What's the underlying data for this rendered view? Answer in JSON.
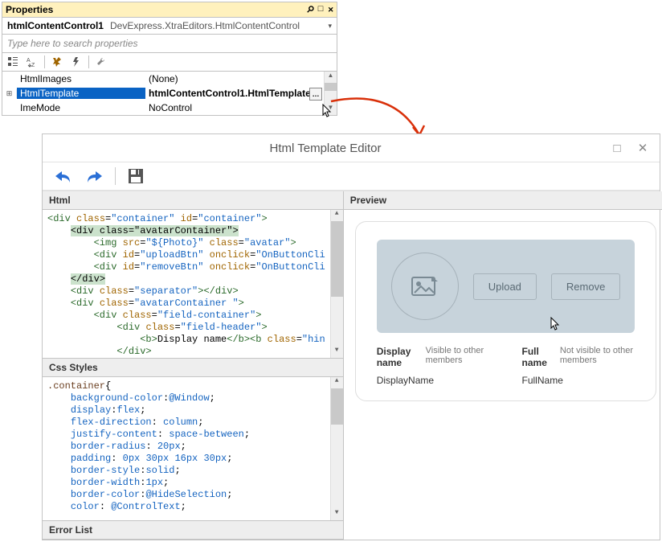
{
  "props": {
    "title": "Properties",
    "object_name": "htmlContentControl1",
    "object_type": "DevExpress.XtraEditors.HtmlContentControl",
    "search_placeholder": "Type here to search properties",
    "rows": [
      {
        "name": "HtmlImages",
        "value": "(None)",
        "expander": ""
      },
      {
        "name": "HtmlTemplate",
        "value": "htmlContentControl1.HtmlTemplate",
        "expander": "⊞",
        "selected": true,
        "ellipsis": true
      },
      {
        "name": "ImeMode",
        "value": "NoControl",
        "expander": ""
      }
    ]
  },
  "editor": {
    "title": "Html Template Editor",
    "tabs": {
      "html": "Html",
      "css": "Css Styles",
      "error": "Error List",
      "preview": "Preview"
    },
    "preview": {
      "upload": "Upload",
      "remove": "Remove",
      "display_label": "Display name",
      "display_hint": "Visible to other members",
      "display_value": "DisplayName",
      "full_label": "Full name",
      "full_hint": "Not visible to other members",
      "full_value": "FullName"
    }
  },
  "code": {
    "html_lines": [
      {
        "indent": 0,
        "parts": [
          {
            "c": "c-t",
            "t": "<div"
          },
          {
            "c": "",
            "t": " "
          },
          {
            "c": "c-a",
            "t": "class"
          },
          {
            "c": "",
            "t": "="
          },
          {
            "c": "c-s",
            "t": "\"container\""
          },
          {
            "c": "",
            "t": " "
          },
          {
            "c": "c-a",
            "t": "id"
          },
          {
            "c": "",
            "t": "="
          },
          {
            "c": "c-s",
            "t": "\"container\""
          },
          {
            "c": "c-t",
            "t": ">"
          }
        ]
      },
      {
        "indent": 1,
        "parts": [
          {
            "c": "c-hl",
            "t": "<div "
          },
          {
            "c": "c-hl",
            "t": "class="
          },
          {
            "c": "c-hl",
            "t": "\"avatarContainer\""
          },
          {
            "c": "c-hl",
            "t": ">"
          }
        ]
      },
      {
        "indent": 2,
        "parts": [
          {
            "c": "c-t",
            "t": "<img"
          },
          {
            "c": "",
            "t": " "
          },
          {
            "c": "c-a",
            "t": "src"
          },
          {
            "c": "",
            "t": "="
          },
          {
            "c": "c-s",
            "t": "\"${Photo}\""
          },
          {
            "c": "",
            "t": " "
          },
          {
            "c": "c-a",
            "t": "class"
          },
          {
            "c": "",
            "t": "="
          },
          {
            "c": "c-s",
            "t": "\"avatar\""
          },
          {
            "c": "c-t",
            "t": ">"
          }
        ]
      },
      {
        "indent": 2,
        "parts": [
          {
            "c": "c-t",
            "t": "<div"
          },
          {
            "c": "",
            "t": " "
          },
          {
            "c": "c-a",
            "t": "id"
          },
          {
            "c": "",
            "t": "="
          },
          {
            "c": "c-s",
            "t": "\"uploadBtn\""
          },
          {
            "c": "",
            "t": " "
          },
          {
            "c": "c-a",
            "t": "onclick"
          },
          {
            "c": "",
            "t": "="
          },
          {
            "c": "c-s",
            "t": "\"OnButtonCli"
          }
        ]
      },
      {
        "indent": 2,
        "parts": [
          {
            "c": "c-t",
            "t": "<div"
          },
          {
            "c": "",
            "t": " "
          },
          {
            "c": "c-a",
            "t": "id"
          },
          {
            "c": "",
            "t": "="
          },
          {
            "c": "c-s",
            "t": "\"removeBtn\""
          },
          {
            "c": "",
            "t": " "
          },
          {
            "c": "c-a",
            "t": "onclick"
          },
          {
            "c": "",
            "t": "="
          },
          {
            "c": "c-s",
            "t": "\"OnButtonCli"
          }
        ]
      },
      {
        "indent": 1,
        "parts": [
          {
            "c": "c-hl",
            "t": "</div>"
          }
        ]
      },
      {
        "indent": 1,
        "parts": [
          {
            "c": "c-t",
            "t": "<div"
          },
          {
            "c": "",
            "t": " "
          },
          {
            "c": "c-a",
            "t": "class"
          },
          {
            "c": "",
            "t": "="
          },
          {
            "c": "c-s",
            "t": "\"separator\""
          },
          {
            "c": "c-t",
            "t": "></div>"
          }
        ]
      },
      {
        "indent": 1,
        "parts": [
          {
            "c": "c-t",
            "t": "<div"
          },
          {
            "c": "",
            "t": " "
          },
          {
            "c": "c-a",
            "t": "class"
          },
          {
            "c": "",
            "t": "="
          },
          {
            "c": "c-s",
            "t": "\"avatarContainer \""
          },
          {
            "c": "c-t",
            "t": ">"
          }
        ]
      },
      {
        "indent": 2,
        "parts": [
          {
            "c": "c-t",
            "t": "<div"
          },
          {
            "c": "",
            "t": " "
          },
          {
            "c": "c-a",
            "t": "class"
          },
          {
            "c": "",
            "t": "="
          },
          {
            "c": "c-s",
            "t": "\"field-container\""
          },
          {
            "c": "c-t",
            "t": ">"
          }
        ]
      },
      {
        "indent": 3,
        "parts": [
          {
            "c": "c-t",
            "t": "<div"
          },
          {
            "c": "",
            "t": " "
          },
          {
            "c": "c-a",
            "t": "class"
          },
          {
            "c": "",
            "t": "="
          },
          {
            "c": "c-s",
            "t": "\"field-header\""
          },
          {
            "c": "c-t",
            "t": ">"
          }
        ]
      },
      {
        "indent": 4,
        "parts": [
          {
            "c": "c-t",
            "t": "<b>"
          },
          {
            "c": "",
            "t": "Display name"
          },
          {
            "c": "c-t",
            "t": "</b><b"
          },
          {
            "c": "",
            "t": " "
          },
          {
            "c": "c-a",
            "t": "class"
          },
          {
            "c": "",
            "t": "="
          },
          {
            "c": "c-s",
            "t": "\"hin"
          }
        ]
      },
      {
        "indent": 3,
        "parts": [
          {
            "c": "c-t",
            "t": "</div>"
          }
        ]
      }
    ],
    "css_lines": [
      {
        "indent": 0,
        "parts": [
          {
            "c": "c-sel",
            "t": ".container"
          },
          {
            "c": "",
            "t": "{"
          }
        ]
      },
      {
        "indent": 1,
        "parts": [
          {
            "c": "c-k",
            "t": "background-color"
          },
          {
            "c": "",
            "t": ":"
          },
          {
            "c": "c-v",
            "t": "@Window"
          },
          {
            "c": "",
            "t": ";"
          }
        ]
      },
      {
        "indent": 1,
        "parts": [
          {
            "c": "c-k",
            "t": "display"
          },
          {
            "c": "",
            "t": ":"
          },
          {
            "c": "c-v",
            "t": "flex"
          },
          {
            "c": "",
            "t": ";"
          }
        ]
      },
      {
        "indent": 1,
        "parts": [
          {
            "c": "c-k",
            "t": "flex-direction"
          },
          {
            "c": "",
            "t": ": "
          },
          {
            "c": "c-v",
            "t": "column"
          },
          {
            "c": "",
            "t": ";"
          }
        ]
      },
      {
        "indent": 1,
        "parts": [
          {
            "c": "c-k",
            "t": "justify-content"
          },
          {
            "c": "",
            "t": ": "
          },
          {
            "c": "c-v",
            "t": "space-between"
          },
          {
            "c": "",
            "t": ";"
          }
        ]
      },
      {
        "indent": 1,
        "parts": [
          {
            "c": "c-k",
            "t": "border-radius"
          },
          {
            "c": "",
            "t": ": "
          },
          {
            "c": "c-v",
            "t": "20px"
          },
          {
            "c": "",
            "t": ";"
          }
        ]
      },
      {
        "indent": 1,
        "parts": [
          {
            "c": "c-k",
            "t": "padding"
          },
          {
            "c": "",
            "t": ": "
          },
          {
            "c": "c-v",
            "t": "0px 30px 16px 30px"
          },
          {
            "c": "",
            "t": ";"
          }
        ]
      },
      {
        "indent": 1,
        "parts": [
          {
            "c": "c-k",
            "t": "border-style"
          },
          {
            "c": "",
            "t": ":"
          },
          {
            "c": "c-v",
            "t": "solid"
          },
          {
            "c": "",
            "t": ";"
          }
        ]
      },
      {
        "indent": 1,
        "parts": [
          {
            "c": "c-k",
            "t": "border-width"
          },
          {
            "c": "",
            "t": ":"
          },
          {
            "c": "c-v",
            "t": "1px"
          },
          {
            "c": "",
            "t": ";"
          }
        ]
      },
      {
        "indent": 1,
        "parts": [
          {
            "c": "c-k",
            "t": "border-color"
          },
          {
            "c": "",
            "t": ":"
          },
          {
            "c": "c-v",
            "t": "@HideSelection"
          },
          {
            "c": "",
            "t": ";"
          }
        ]
      },
      {
        "indent": 1,
        "parts": [
          {
            "c": "c-k",
            "t": "color"
          },
          {
            "c": "",
            "t": ": "
          },
          {
            "c": "c-v",
            "t": "@ControlText"
          },
          {
            "c": "",
            "t": ";"
          }
        ]
      }
    ]
  }
}
